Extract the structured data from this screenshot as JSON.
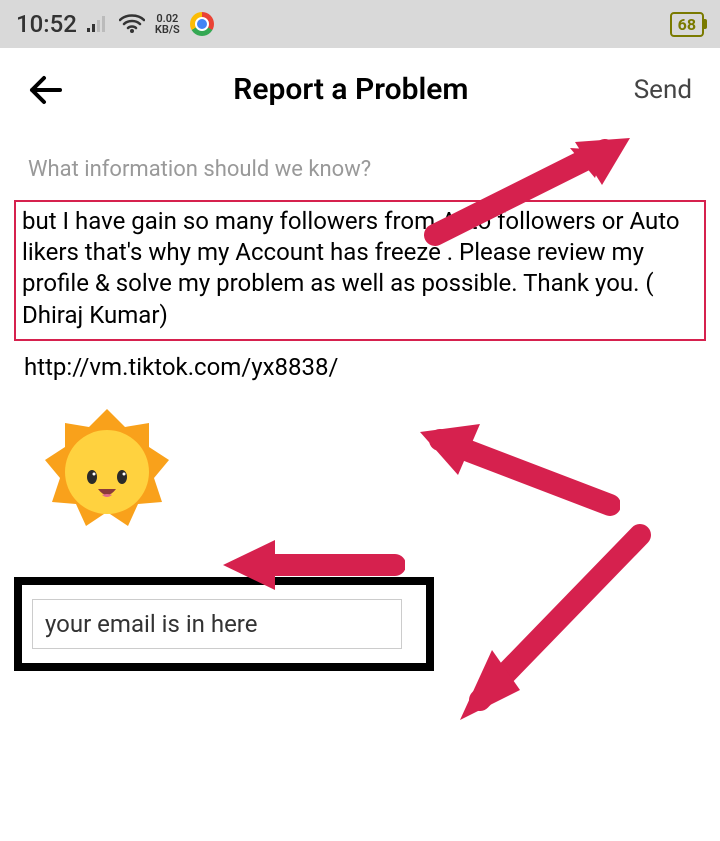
{
  "status_bar": {
    "time": "10:52",
    "network_speed_value": "0.02",
    "network_speed_unit": "KB/S",
    "battery": "68"
  },
  "header": {
    "title": "Report a Problem",
    "send_label": "Send"
  },
  "prompt_text": "What information should we know?",
  "report_text": "but I have gain so many followers from Auto followers or Auto likers that's why my Account has freeze . Please review my profile & solve my problem as well as possible. Thank you. ( Dhiraj Kumar)",
  "url_text": "http://vm.tiktok.com/yx8838/",
  "email_placeholder": "your email is in here"
}
